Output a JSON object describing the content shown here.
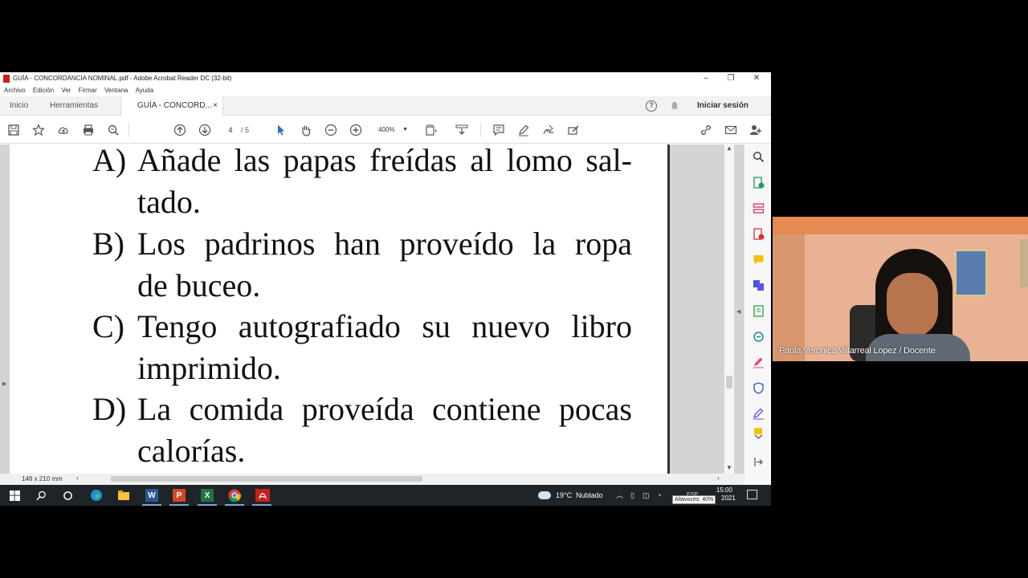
{
  "window": {
    "title": "GUÍA - CONCORDANCIA NOMINAL.pdf - Adobe Acrobat Reader DC (32-bit)",
    "minimize": "–",
    "restore": "❐",
    "close": "✕"
  },
  "menu": [
    "Archivo",
    "Edición",
    "Ver",
    "Firmar",
    "Ventana",
    "Ayuda"
  ],
  "tabs": {
    "home": "Inicio",
    "tools": "Herramientas",
    "doc": "GUÍA - CONCORD...",
    "doc_close": "×",
    "help": "?",
    "signin": "Iniciar sesión"
  },
  "toolbar": {
    "page_current": "4",
    "page_total": "/ 5",
    "zoom": "400%"
  },
  "document": {
    "options": [
      {
        "letter": "A)",
        "line1": "Añade las papas freídas al lomo sal-",
        "line2": "tado."
      },
      {
        "letter": "B)",
        "line1": "Los padrinos han proveído la ropa",
        "line2": "de buceo."
      },
      {
        "letter": "C)",
        "line1": "Tengo autografiado su nuevo libro",
        "line2": "imprimido."
      },
      {
        "letter": "D)",
        "line1": "La comida proveída contiene pocas",
        "line2": "calorías."
      }
    ]
  },
  "statusbar": {
    "page_size": "148 x 210 mm"
  },
  "taskbar": {
    "apps": [
      "W",
      "P",
      "X"
    ],
    "weather_temp": "19°C",
    "weather_desc": "Nublado",
    "time": "15:00",
    "date": "2021",
    "lang": "ESP",
    "tooltip": "Altavoces: 40%"
  },
  "webcam": {
    "participant": "Paula Veronica Villarreal Lopez / Docente"
  },
  "colors": {
    "acrobat_red": "#c8201b",
    "taskbar_bg": "#1e2428",
    "accent_blue": "#2b6fcc"
  }
}
